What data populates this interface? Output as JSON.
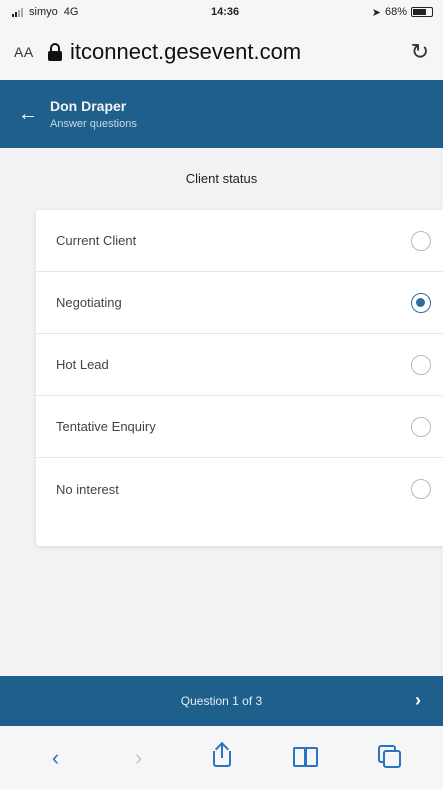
{
  "status_bar": {
    "carrier": "simyo",
    "network": "4G",
    "time": "14:36",
    "battery": "68%"
  },
  "browser": {
    "text_size_label": "AA",
    "url": "itconnect.gesevent.com",
    "reload_icon": "reload-icon"
  },
  "header": {
    "name": "Don Draper",
    "subtitle": "Answer questions",
    "back_icon": "arrow-left-icon"
  },
  "question": {
    "title": "Client status",
    "options": [
      {
        "label": "Current Client",
        "selected": false
      },
      {
        "label": "Negotiating",
        "selected": true
      },
      {
        "label": "Hot Lead",
        "selected": false
      },
      {
        "label": "Tentative Enquiry",
        "selected": false
      },
      {
        "label": "No interest",
        "selected": false
      }
    ]
  },
  "footer": {
    "progress_label": "Question 1 of 3",
    "next_icon": "chevron-right-icon"
  },
  "colors": {
    "primary": "#1f5f8b",
    "accent": "#2a6fa0",
    "safari_blue": "#2a74c6"
  }
}
